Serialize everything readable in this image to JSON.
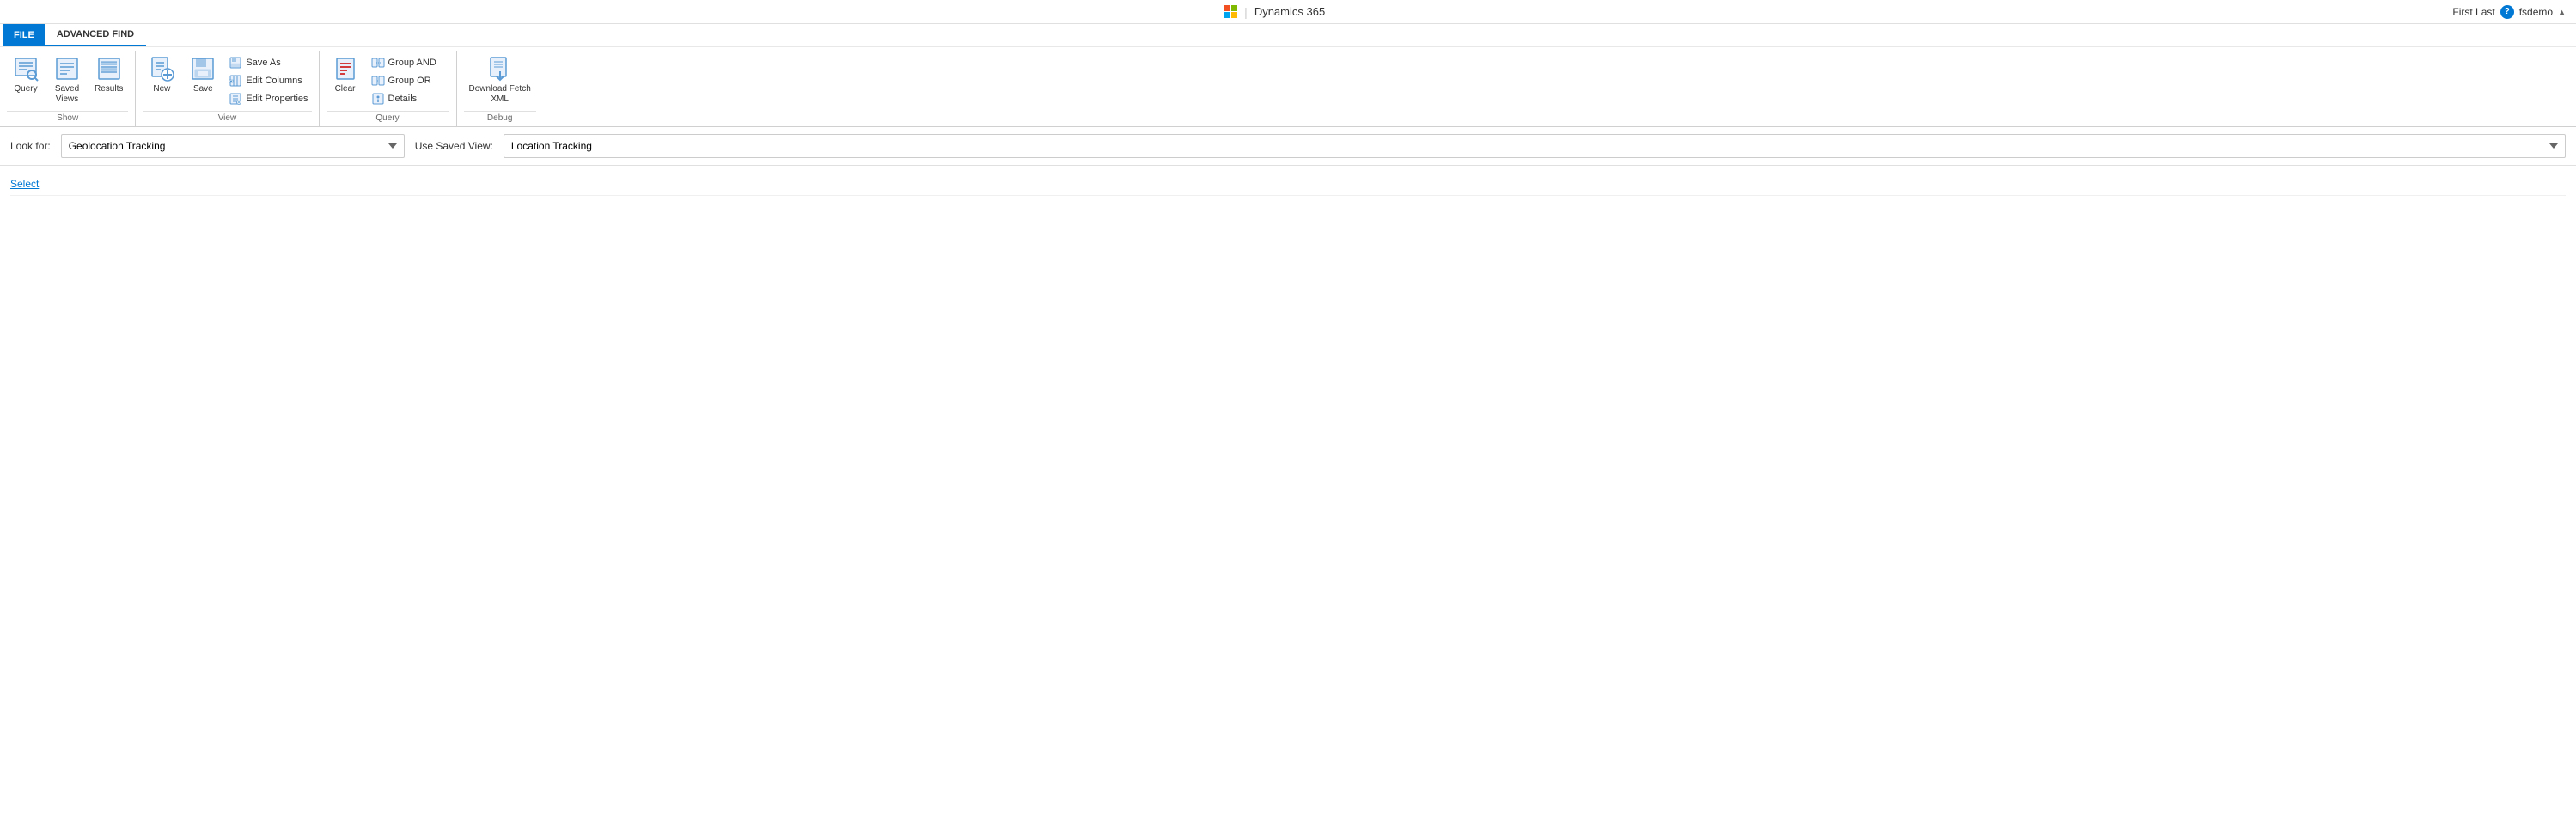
{
  "topbar": {
    "app_name": "Dynamics 365",
    "separator": "|",
    "user": {
      "name": "First Last",
      "username": "fsdemo",
      "help_label": "?"
    }
  },
  "ribbon": {
    "tab_file": "FILE",
    "tab_advanced_find": "ADVANCED FIND",
    "groups": {
      "show": {
        "label": "Show",
        "buttons": [
          {
            "id": "query",
            "label": "Query"
          },
          {
            "id": "saved-views",
            "label": "Saved\nViews"
          },
          {
            "id": "results",
            "label": "Results"
          }
        ]
      },
      "view": {
        "label": "View",
        "buttons_large": [
          {
            "id": "new",
            "label": "New"
          },
          {
            "id": "save",
            "label": "Save"
          }
        ],
        "buttons_small": [
          {
            "id": "save-as",
            "label": "Save As"
          },
          {
            "id": "edit-columns",
            "label": "Edit Columns"
          },
          {
            "id": "edit-properties",
            "label": "Edit Properties"
          }
        ]
      },
      "query": {
        "label": "Query",
        "buttons_large": [
          {
            "id": "clear",
            "label": "Clear"
          }
        ],
        "buttons_small": [
          {
            "id": "group-and",
            "label": "Group AND"
          },
          {
            "id": "group-or",
            "label": "Group OR"
          },
          {
            "id": "details",
            "label": "Details"
          }
        ]
      },
      "debug": {
        "label": "Debug",
        "buttons": [
          {
            "id": "download-fetch-xml",
            "label": "Download Fetch\nXML"
          }
        ]
      }
    }
  },
  "lookup": {
    "look_for_label": "Look for:",
    "look_for_value": "Geolocation Tracking",
    "use_saved_view_label": "Use Saved View:",
    "use_saved_view_value": "Location Tracking"
  },
  "main": {
    "select_link": "Select"
  }
}
